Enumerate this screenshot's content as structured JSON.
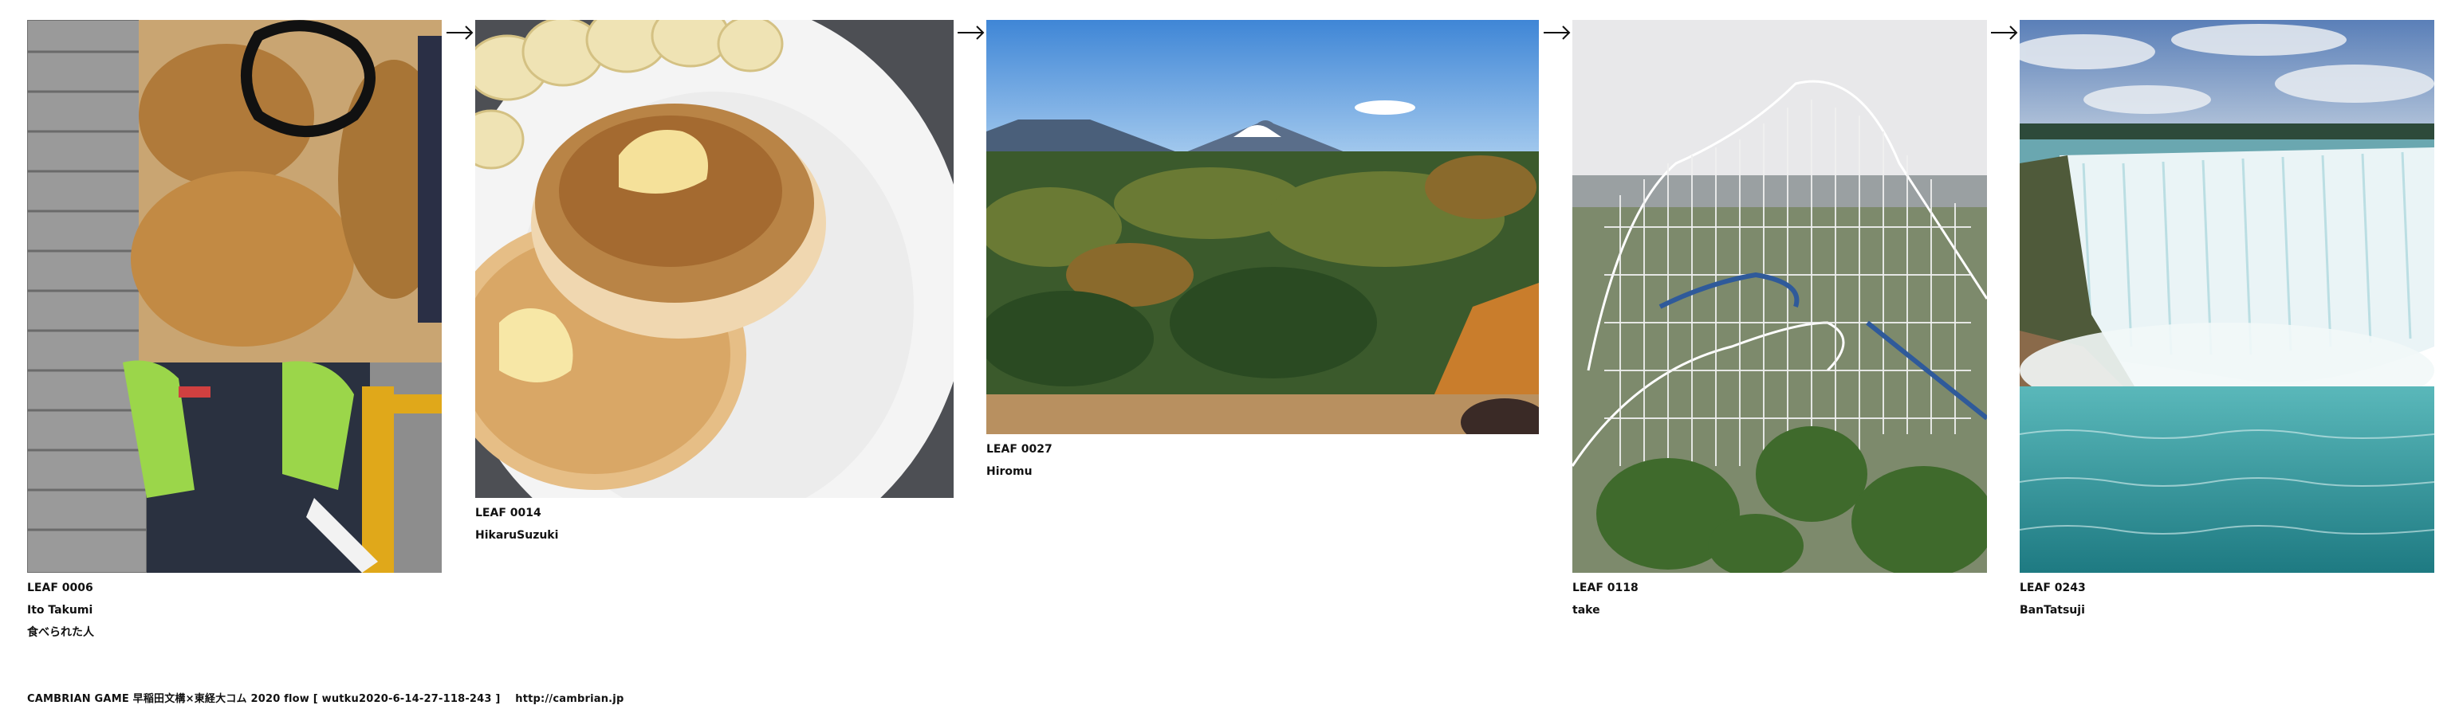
{
  "flow": {
    "leaves": [
      {
        "id_label": "LEAF 0006",
        "author": "Ito Takumi",
        "note": "食べられた人",
        "photo_subject": "taiyaki-poster-person-photo"
      },
      {
        "id_label": "LEAF 0014",
        "author": "HikaruSuzuki",
        "note": "",
        "photo_subject": "pancakes-photo"
      },
      {
        "id_label": "LEAF 0027",
        "author": "Hiromu",
        "note": "",
        "photo_subject": "mount-fuji-forest-photo"
      },
      {
        "id_label": "LEAF 0118",
        "author": "take",
        "note": "",
        "photo_subject": "roller-coaster-photo"
      },
      {
        "id_label": "LEAF 0243",
        "author": "BanTatsuji",
        "note": "",
        "photo_subject": "waterfall-photo"
      }
    ],
    "arrow_icon": "right-arrow-icon"
  },
  "footer": {
    "credit": "CAMBRIAN GAME  早稲田文構×東経大コム 2020  flow [ wutku2020-6-14-27-118-243 ]",
    "url": "http://cambrian.jp"
  }
}
